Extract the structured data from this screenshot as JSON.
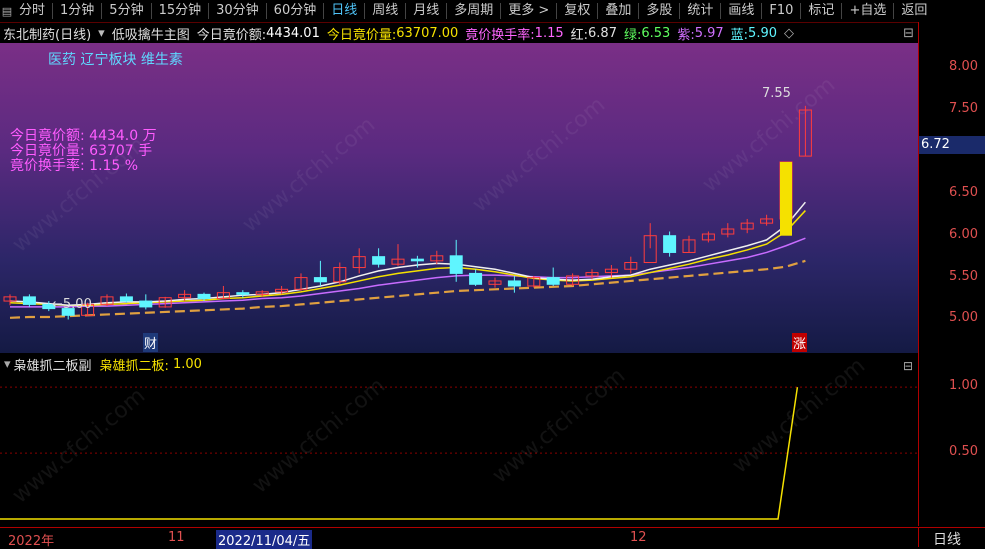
{
  "toolbar": {
    "items": [
      "分时",
      "1分钟",
      "5分钟",
      "15分钟",
      "30分钟",
      "60分钟",
      "日线",
      "周线",
      "月线",
      "多周期",
      "更多 >",
      "复权",
      "叠加",
      "多股",
      "统计",
      "画线",
      "F10",
      "标记",
      "+自选",
      "返回"
    ],
    "active": "日线"
  },
  "info": {
    "stock": "东北制药(日线)",
    "indicator": "低吸擒牛主图",
    "amount_label": "今日竟价额:",
    "amount_value": "4434.01",
    "volume_label": "今日竟价量:",
    "volume_value": "63707.00",
    "turnover_label": "竟价换手率:",
    "turnover_value": "1.15",
    "red_label": "红:",
    "red_value": "6.87",
    "green_label": "绿:",
    "green_value": "6.53",
    "purple_label": "紫:",
    "purple_value": "5.97",
    "blue_label": "蓝:",
    "blue_value": "5.90"
  },
  "sectors": "医药  辽宁板块  维生素",
  "overlay": {
    "line1": "今日竟价额:  4434.0  万",
    "line2": "今日竟价量:  63707  手",
    "line3": "竟价换手率:  1.15  %"
  },
  "watermark": "www.cfchi.com",
  "markers": {
    "cai": "财",
    "zhang": "涨",
    "high": "7.55",
    "low": "5.00",
    "current_price": "6.72"
  },
  "sub": {
    "title": "枭雄抓二板副",
    "label": "枭雄抓二板:",
    "value": "1.00"
  },
  "bottom": {
    "year": "2022年",
    "nov": "11",
    "date": "2022/11/04/五",
    "dec": "12",
    "period": "日线"
  },
  "colors": {
    "up": "#ff3d3d",
    "down": "#5ff5ff",
    "ma_white": "#f0f0f0",
    "ma_yellow": "#f5e100",
    "ma_purple": "#c86cff",
    "ma_orange": "#e0a040",
    "signal": "#f5e100"
  },
  "chart_data": {
    "type": "candlestick",
    "price_axis": {
      "ticks": [
        "8.00",
        "7.50",
        "7.00",
        "6.50",
        "6.00",
        "5.50",
        "5.00"
      ],
      "range": [
        4.6,
        8.3
      ]
    },
    "sub_axis": {
      "ticks": [
        "1.00",
        "0.50"
      ],
      "range": [
        0,
        1.1
      ]
    },
    "candles": [
      {
        "o": 5.22,
        "h": 5.3,
        "l": 5.17,
        "c": 5.27
      },
      {
        "o": 5.27,
        "h": 5.3,
        "l": 5.15,
        "c": 5.18
      },
      {
        "o": 5.18,
        "h": 5.22,
        "l": 5.1,
        "c": 5.13
      },
      {
        "o": 5.13,
        "h": 5.12,
        "l": 5.0,
        "c": 5.05
      },
      {
        "o": 5.05,
        "h": 5.2,
        "l": 5.04,
        "c": 5.18
      },
      {
        "o": 5.18,
        "h": 5.3,
        "l": 5.16,
        "c": 5.27
      },
      {
        "o": 5.27,
        "h": 5.31,
        "l": 5.2,
        "c": 5.22
      },
      {
        "o": 5.22,
        "h": 5.3,
        "l": 5.12,
        "c": 5.15
      },
      {
        "o": 5.15,
        "h": 5.27,
        "l": 5.14,
        "c": 5.26
      },
      {
        "o": 5.26,
        "h": 5.35,
        "l": 5.22,
        "c": 5.3
      },
      {
        "o": 5.3,
        "h": 5.32,
        "l": 5.22,
        "c": 5.25
      },
      {
        "o": 5.25,
        "h": 5.4,
        "l": 5.24,
        "c": 5.32
      },
      {
        "o": 5.32,
        "h": 5.35,
        "l": 5.26,
        "c": 5.3
      },
      {
        "o": 5.3,
        "h": 5.35,
        "l": 5.27,
        "c": 5.33
      },
      {
        "o": 5.33,
        "h": 5.4,
        "l": 5.3,
        "c": 5.36
      },
      {
        "o": 5.36,
        "h": 5.55,
        "l": 5.34,
        "c": 5.5
      },
      {
        "o": 5.5,
        "h": 5.7,
        "l": 5.4,
        "c": 5.45
      },
      {
        "o": 5.45,
        "h": 5.68,
        "l": 5.42,
        "c": 5.62
      },
      {
        "o": 5.62,
        "h": 5.85,
        "l": 5.55,
        "c": 5.75
      },
      {
        "o": 5.75,
        "h": 5.85,
        "l": 5.62,
        "c": 5.66
      },
      {
        "o": 5.66,
        "h": 5.9,
        "l": 5.64,
        "c": 5.72
      },
      {
        "o": 5.72,
        "h": 5.76,
        "l": 5.62,
        "c": 5.7
      },
      {
        "o": 5.7,
        "h": 5.82,
        "l": 5.66,
        "c": 5.76
      },
      {
        "o": 5.76,
        "h": 5.95,
        "l": 5.45,
        "c": 5.55
      },
      {
        "o": 5.55,
        "h": 5.6,
        "l": 5.4,
        "c": 5.42
      },
      {
        "o": 5.42,
        "h": 5.5,
        "l": 5.38,
        "c": 5.46
      },
      {
        "o": 5.46,
        "h": 5.52,
        "l": 5.32,
        "c": 5.4
      },
      {
        "o": 5.4,
        "h": 5.52,
        "l": 5.38,
        "c": 5.5
      },
      {
        "o": 5.5,
        "h": 5.62,
        "l": 5.4,
        "c": 5.42
      },
      {
        "o": 5.42,
        "h": 5.55,
        "l": 5.4,
        "c": 5.52
      },
      {
        "o": 5.52,
        "h": 5.6,
        "l": 5.48,
        "c": 5.56
      },
      {
        "o": 5.56,
        "h": 5.65,
        "l": 5.5,
        "c": 5.6
      },
      {
        "o": 5.6,
        "h": 5.75,
        "l": 5.55,
        "c": 5.68
      },
      {
        "o": 5.68,
        "h": 6.15,
        "l": 5.85,
        "c": 6.0
      },
      {
        "o": 6.0,
        "h": 6.05,
        "l": 5.75,
        "c": 5.8
      },
      {
        "o": 5.8,
        "h": 6.0,
        "l": 5.8,
        "c": 5.95
      },
      {
        "o": 5.95,
        "h": 6.05,
        "l": 5.92,
        "c": 6.02
      },
      {
        "o": 6.02,
        "h": 6.15,
        "l": 5.98,
        "c": 6.08
      },
      {
        "o": 6.08,
        "h": 6.2,
        "l": 6.03,
        "c": 6.15
      },
      {
        "o": 6.15,
        "h": 6.25,
        "l": 6.12,
        "c": 6.2
      },
      {
        "o": 6.2,
        "h": 6.88,
        "l": 6.15,
        "c": 6.88
      },
      {
        "o": 6.95,
        "h": 7.55,
        "l": 6.95,
        "c": 7.5
      }
    ],
    "ma_white": [
      5.22,
      5.21,
      5.19,
      5.17,
      5.18,
      5.2,
      5.21,
      5.21,
      5.22,
      5.24,
      5.25,
      5.27,
      5.29,
      5.3,
      5.32,
      5.36,
      5.4,
      5.45,
      5.52,
      5.58,
      5.62,
      5.65,
      5.67,
      5.66,
      5.63,
      5.6,
      5.55,
      5.5,
      5.48,
      5.47,
      5.48,
      5.51,
      5.53,
      5.6,
      5.65,
      5.7,
      5.76,
      5.82,
      5.88,
      5.95,
      6.12,
      6.4
    ],
    "ma_yellow": [
      5.2,
      5.19,
      5.18,
      5.17,
      5.17,
      5.18,
      5.19,
      5.2,
      5.21,
      5.22,
      5.23,
      5.25,
      5.26,
      5.28,
      5.3,
      5.33,
      5.37,
      5.41,
      5.46,
      5.51,
      5.55,
      5.58,
      5.61,
      5.62,
      5.6,
      5.57,
      5.53,
      5.49,
      5.47,
      5.46,
      5.47,
      5.49,
      5.51,
      5.56,
      5.61,
      5.66,
      5.72,
      5.77,
      5.83,
      5.9,
      6.05,
      6.3
    ],
    "ma_purple": [
      5.15,
      5.15,
      5.15,
      5.15,
      5.16,
      5.16,
      5.17,
      5.18,
      5.19,
      5.2,
      5.21,
      5.22,
      5.23,
      5.25,
      5.26,
      5.28,
      5.31,
      5.34,
      5.37,
      5.41,
      5.44,
      5.47,
      5.5,
      5.52,
      5.53,
      5.53,
      5.52,
      5.51,
      5.5,
      5.5,
      5.51,
      5.52,
      5.53,
      5.56,
      5.59,
      5.62,
      5.66,
      5.7,
      5.74,
      5.8,
      5.88,
      5.97
    ],
    "ma_orange": [
      5.02,
      5.03,
      5.03,
      5.04,
      5.05,
      5.06,
      5.07,
      5.08,
      5.09,
      5.1,
      5.11,
      5.12,
      5.13,
      5.15,
      5.16,
      5.18,
      5.2,
      5.22,
      5.24,
      5.26,
      5.28,
      5.3,
      5.32,
      5.34,
      5.35,
      5.36,
      5.37,
      5.38,
      5.39,
      5.4,
      5.42,
      5.44,
      5.46,
      5.48,
      5.5,
      5.52,
      5.54,
      5.56,
      5.58,
      5.6,
      5.63,
      5.7
    ],
    "signal": [
      0,
      0,
      0,
      0,
      0,
      0,
      0,
      0,
      0,
      0,
      0,
      0,
      0,
      0,
      0,
      0,
      0,
      0,
      0,
      0,
      0,
      0,
      0,
      0,
      0,
      0,
      0,
      0,
      0,
      0,
      0,
      0,
      0,
      0,
      0,
      0,
      0,
      0,
      0,
      0,
      0,
      1
    ]
  }
}
